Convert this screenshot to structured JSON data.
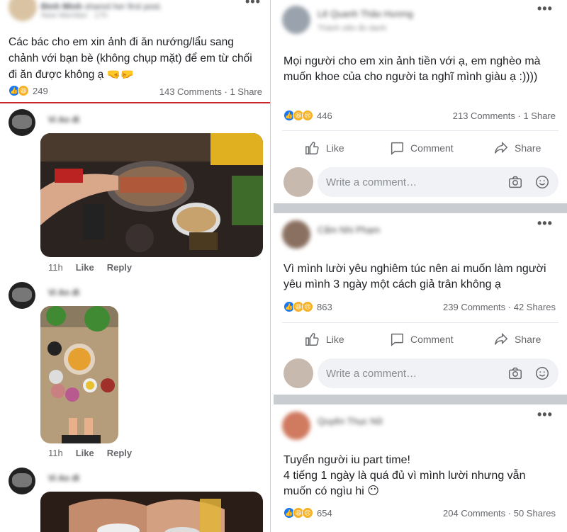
{
  "left": {
    "post": {
      "author": "Đinh Minh",
      "author_suffix": "shared her first post.",
      "badge": "New Member",
      "time": "17h",
      "text": "Các bác cho em xin ảnh đi ăn nướng/lẩu sang chảnh với bạn bè (không chụp mặt) để em từ chối đi ăn được không ạ 🤜🤛",
      "reaction_count": "249",
      "comments": "143 Comments",
      "shares": "1 Share",
      "more": "•••"
    },
    "comments": [
      {
        "name": "Vi An đi",
        "time": "11h",
        "like": "Like",
        "reply": "Reply"
      },
      {
        "name": "Vi An đi",
        "time": "11h",
        "like": "Like",
        "reply": "Reply"
      },
      {
        "name": "Vi An đi"
      }
    ]
  },
  "right": {
    "posts": [
      {
        "author": "Lê Quanh Thảo Hương",
        "sub": "Thành viên ẩn danh",
        "text": "Mọi người cho em xin ảnh tiền với ạ, em nghèo mà muốn khoe của cho người ta nghĩ mình giàu ạ :))))",
        "reaction_count": "446",
        "comments": "213 Comments",
        "shares": "1 Share",
        "more": "•••"
      },
      {
        "author": "Cẩm Nhi Phạm",
        "sub": "",
        "text": "Vì mình lười yêu nghiêm túc nên ai muốn làm người yêu mình 3 ngày một cách giả trân không ạ",
        "reaction_count": "863",
        "comments": "239 Comments",
        "shares": "42 Shares",
        "more": "•••"
      },
      {
        "author": "Quyên Thục Nữ",
        "sub": "",
        "text": "Tuyển người iu part time!\n4 tiếng 1 ngày là quá đủ vì mình lười nhưng vẫn muốn có ngìu hi 😶",
        "reaction_count": "654",
        "comments": "204 Comments",
        "shares": "50 Shares",
        "more": "•••"
      }
    ],
    "actions": {
      "like": "Like",
      "comment": "Comment",
      "share": "Share"
    },
    "comment_placeholder": "Write a comment…"
  },
  "colors": {
    "facebook_blue": "#1877f2",
    "divider_red": "#c9262c",
    "gray_text": "#65676b"
  },
  "icons": [
    "like-icon",
    "haha-icon",
    "sad-icon",
    "camera-icon",
    "emoji-icon",
    "comment-icon",
    "share-icon",
    "more-icon"
  ]
}
